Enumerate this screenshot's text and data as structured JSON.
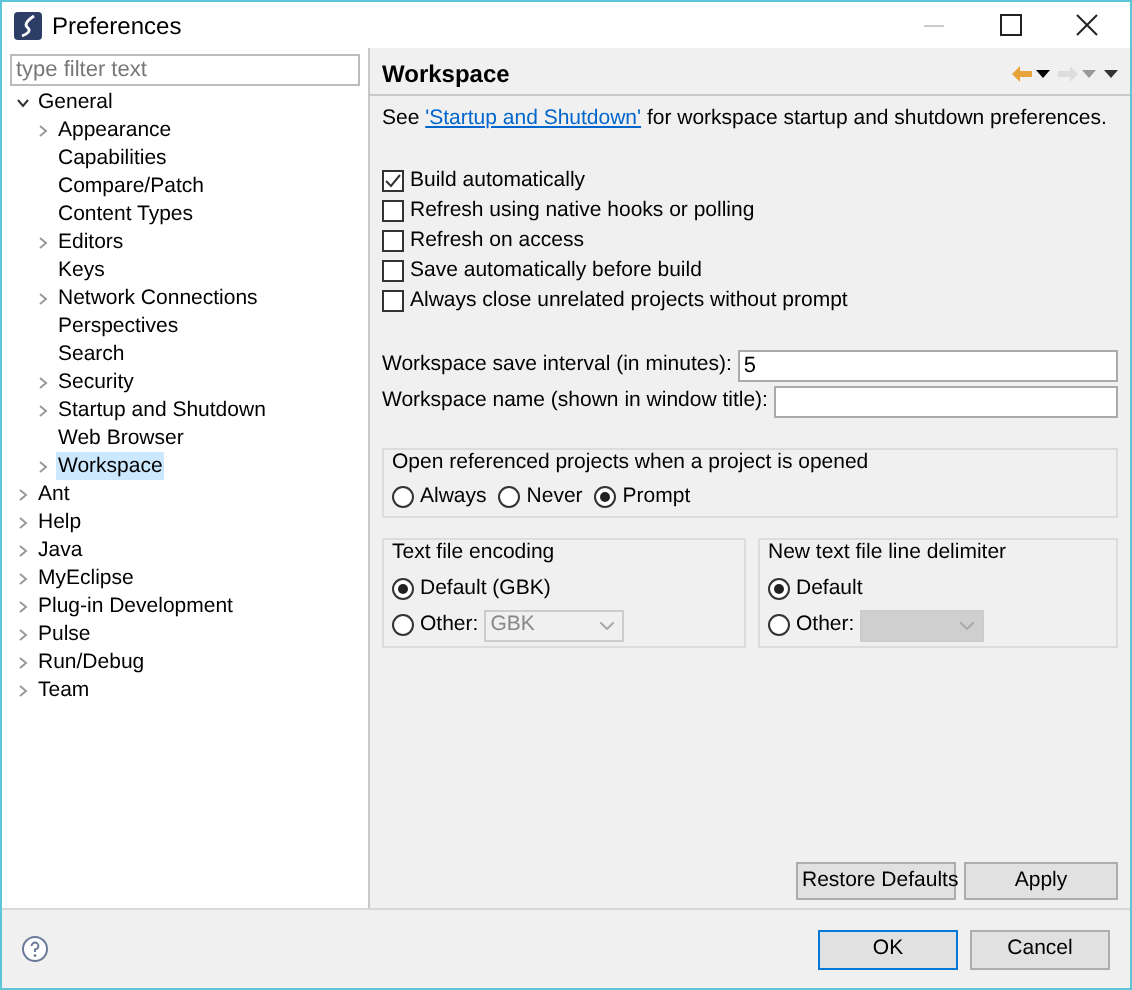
{
  "window": {
    "title": "Preferences"
  },
  "filter": {
    "placeholder": "type filter text"
  },
  "tree": [
    {
      "label": "General",
      "expanded": true,
      "selected": false,
      "children": [
        {
          "label": "Appearance",
          "expanded": false,
          "selected": false
        },
        {
          "label": "Capabilities",
          "selected": false
        },
        {
          "label": "Compare/Patch",
          "selected": false
        },
        {
          "label": "Content Types",
          "selected": false
        },
        {
          "label": "Editors",
          "expanded": false,
          "selected": false
        },
        {
          "label": "Keys",
          "selected": false
        },
        {
          "label": "Network Connections",
          "expanded": false,
          "selected": false
        },
        {
          "label": "Perspectives",
          "selected": false
        },
        {
          "label": "Search",
          "selected": false
        },
        {
          "label": "Security",
          "expanded": false,
          "selected": false
        },
        {
          "label": "Startup and Shutdown",
          "expanded": false,
          "selected": false
        },
        {
          "label": "Web Browser",
          "selected": false
        },
        {
          "label": "Workspace",
          "expanded": false,
          "selected": true
        }
      ]
    },
    {
      "label": "Ant",
      "expanded": false,
      "selected": false
    },
    {
      "label": "Help",
      "expanded": false,
      "selected": false
    },
    {
      "label": "Java",
      "expanded": false,
      "selected": false
    },
    {
      "label": "MyEclipse",
      "expanded": false,
      "selected": false
    },
    {
      "label": "Plug-in Development",
      "expanded": false,
      "selected": false
    },
    {
      "label": "Pulse",
      "expanded": false,
      "selected": false
    },
    {
      "label": "Run/Debug",
      "expanded": false,
      "selected": false
    },
    {
      "label": "Team",
      "expanded": false,
      "selected": false
    }
  ],
  "page": {
    "title": "Workspace",
    "intro_before": "See ",
    "intro_link": "'Startup and Shutdown'",
    "intro_after": " for workspace startup and shutdown preferences.",
    "checkboxes": [
      {
        "label": "Build automatically",
        "checked": true
      },
      {
        "label": "Refresh using native hooks or polling",
        "checked": false
      },
      {
        "label": "Refresh on access",
        "checked": false
      },
      {
        "label": "Save automatically before build",
        "checked": false
      },
      {
        "label": "Always close unrelated projects without prompt",
        "checked": false
      }
    ],
    "fields": [
      {
        "label": "Workspace save interval (in minutes):",
        "value": "5"
      },
      {
        "label": "Workspace name (shown in window title):"
      }
    ],
    "open_group": {
      "title": "Open referenced projects when a project is opened",
      "options": [
        {
          "label": "Always",
          "selected": false
        },
        {
          "label": "Never",
          "selected": false
        },
        {
          "label": "Prompt",
          "selected": true
        }
      ]
    },
    "encoding": {
      "title": "Text file encoding",
      "default_label": "Default (GBK)",
      "default_selected": true,
      "other_label": "Other:",
      "other_selected": false,
      "other_value": "GBK"
    },
    "delimiter": {
      "title": "New text file line delimiter",
      "default_label": "Default",
      "default_selected": true,
      "other_label": "Other:",
      "other_selected": false
    },
    "buttons": [
      "Restore Defaults",
      "Apply"
    ]
  },
  "dialog_buttons": [
    "OK",
    "Cancel"
  ]
}
